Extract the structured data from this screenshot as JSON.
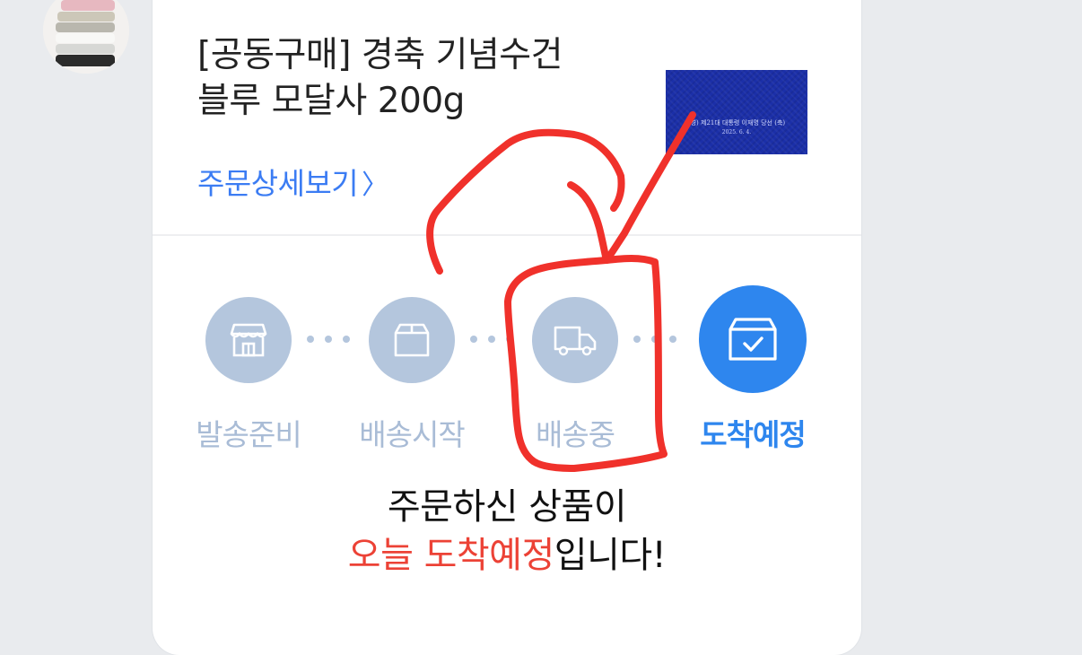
{
  "product": {
    "title_line1": "[공동구매] 경축 기념수건",
    "title_line2": "블루 모달사 200g",
    "detail_link": "주문상세보기",
    "thumbnail_text_line1": "(경) 제21대 대통령 이재명 당선 (축)",
    "thumbnail_text_line2": "2025. 6. 4."
  },
  "steps": [
    {
      "label": "발송준비",
      "icon": "store-icon",
      "state": "done"
    },
    {
      "label": "배송시작",
      "icon": "box-icon",
      "state": "done"
    },
    {
      "label": "배송중",
      "icon": "truck-icon",
      "state": "done"
    },
    {
      "label": "도착예정",
      "icon": "box-check-icon",
      "state": "active"
    }
  ],
  "status_message": {
    "line1": "주문하신 상품이",
    "highlight": "오늘 도착예정",
    "suffix": "입니다!"
  },
  "colors": {
    "accent": "#2e86ee",
    "inactive": "#b4c6dd",
    "highlight": "#ec4236",
    "link": "#3b7cf3",
    "annotation": "#f0312b"
  }
}
